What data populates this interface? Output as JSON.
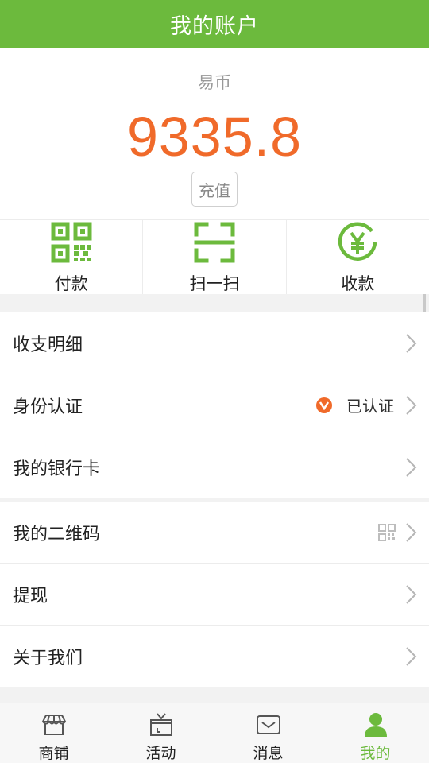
{
  "header": {
    "title": "我的账户"
  },
  "balance": {
    "label": "易币",
    "amount": "9335.8",
    "recharge_label": "充值",
    "amount_color": "#f06a2a"
  },
  "actions": [
    {
      "label": "付款",
      "icon": "qr-code-icon"
    },
    {
      "label": "扫一扫",
      "icon": "scan-frame-icon"
    },
    {
      "label": "收款",
      "icon": "yen-circle-icon"
    }
  ],
  "menu_group1": [
    {
      "label": "收支明细"
    },
    {
      "label": "身份认证",
      "status": "已认证",
      "status_icon": "verified-check-icon"
    },
    {
      "label": "我的银行卡"
    }
  ],
  "menu_group2": [
    {
      "label": "我的二维码",
      "icon": "small-qr-icon"
    },
    {
      "label": "提现"
    },
    {
      "label": "关于我们"
    }
  ],
  "bottom_nav": [
    {
      "label": "商铺",
      "icon": "shop-icon",
      "active": false
    },
    {
      "label": "活动",
      "icon": "gift-icon",
      "active": false
    },
    {
      "label": "消息",
      "icon": "message-icon",
      "active": false
    },
    {
      "label": "我的",
      "icon": "person-icon",
      "active": true
    }
  ],
  "colors": {
    "brand": "#6cba3d",
    "accent": "#f06a2a"
  }
}
